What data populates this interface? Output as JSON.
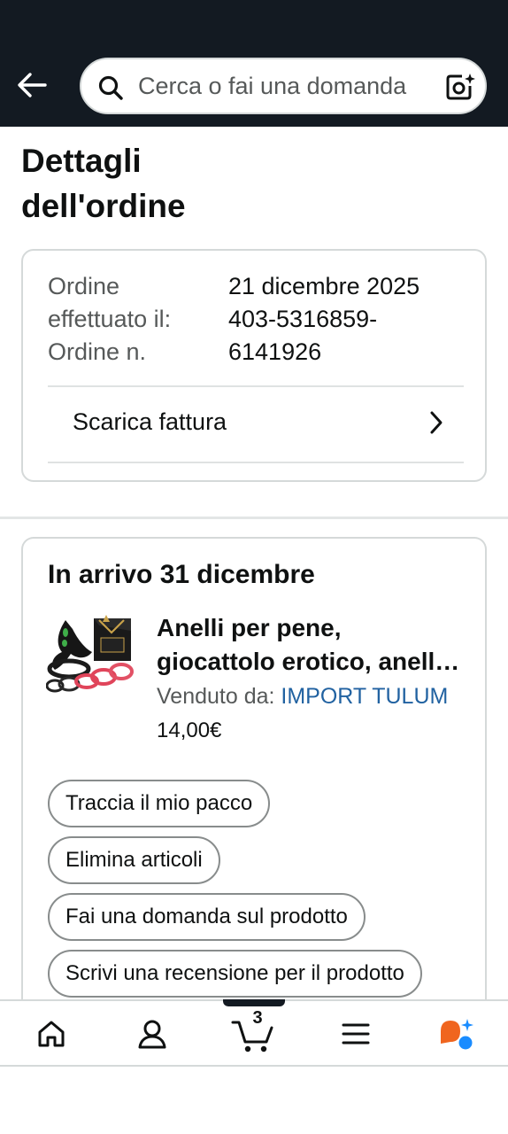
{
  "header": {
    "search_placeholder": "Cerca o fai una domanda"
  },
  "page": {
    "title": "Dettagli dell'ordine"
  },
  "order_summary": {
    "labels": [
      "Ordine",
      "effettuato il:",
      "Ordine n."
    ],
    "values": [
      "21 dicembre 2025",
      "403-5316859-",
      "6141926"
    ],
    "invoice_label": "Scarica fattura"
  },
  "shipment": {
    "title": "In arrivo 31 dicembre",
    "product": {
      "title": "Anelli per pene, giocattolo erotico, anelli in silicone",
      "sold_by_label": "Venduto da: ",
      "seller": "IMPORT TULUM",
      "price": "14,00€"
    },
    "actions": [
      "Traccia il mio pacco",
      "Elimina articoli",
      "Fai una domanda sul prodotto",
      "Scrivi una recensione per il prodotto"
    ]
  },
  "bottom_nav": {
    "cart_count": "3",
    "items": [
      "home-icon",
      "account-icon",
      "cart-icon",
      "menu-icon",
      "assistant-icon"
    ]
  },
  "colors": {
    "header_bg": "#131a22",
    "link": "#2162a1",
    "assistant_orange": "#f0651f",
    "assistant_blue": "#1a8cff"
  }
}
